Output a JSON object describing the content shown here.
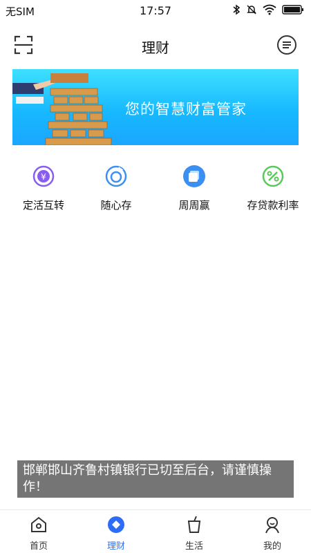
{
  "status": {
    "carrier": "无SIM",
    "time": "17:57"
  },
  "header": {
    "title": "理财"
  },
  "banner": {
    "text": "您的智慧财富管家"
  },
  "quick": [
    {
      "label": "定活互转",
      "icon": "yuan-cycle-icon"
    },
    {
      "label": "随心存",
      "icon": "coin-sync-icon"
    },
    {
      "label": "周周赢",
      "icon": "stack-square-icon"
    },
    {
      "label": "存贷款利率",
      "icon": "percent-icon"
    }
  ],
  "toast": {
    "text": "邯郸邯山齐鲁村镇银行已切至后台，请谨慎操作！"
  },
  "tabbar": [
    {
      "label": "首页",
      "icon": "home-icon",
      "active": false
    },
    {
      "label": "理财",
      "icon": "finance-icon",
      "active": true
    },
    {
      "label": "生活",
      "icon": "cup-icon",
      "active": false
    },
    {
      "label": "我的",
      "icon": "user-icon",
      "active": false
    }
  ],
  "colors": {
    "accent": "#2d6df6",
    "banner_top": "#3fe0ff",
    "banner_bottom": "#1aa6ff"
  }
}
